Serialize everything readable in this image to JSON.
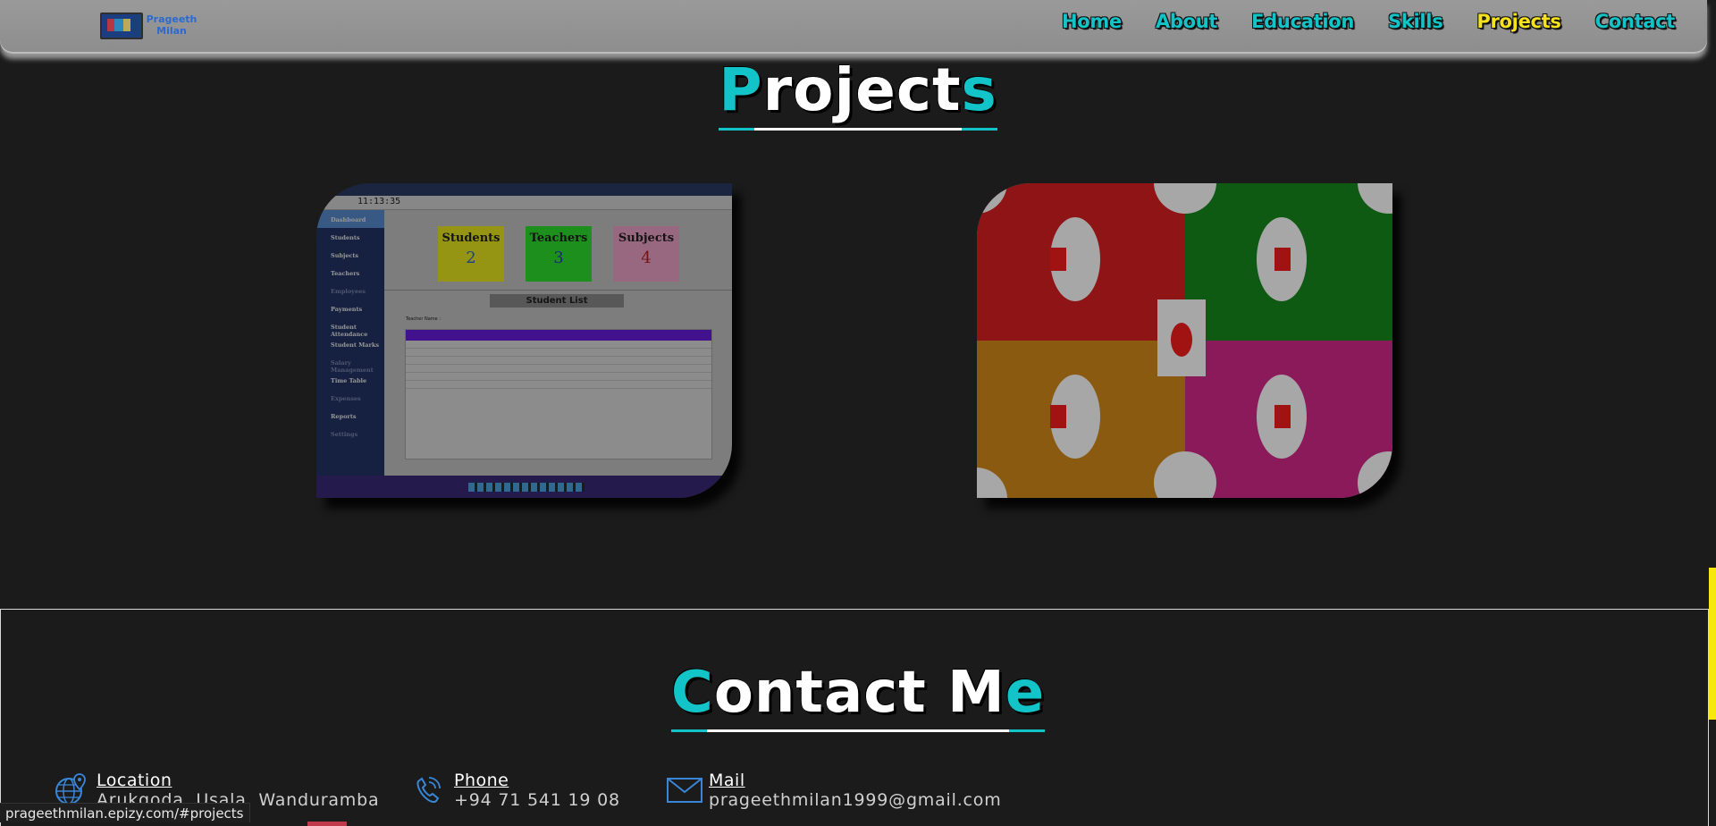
{
  "logo": {
    "line1": "Prageeth",
    "line2": "Milan"
  },
  "nav": {
    "items": [
      "Home",
      "About",
      "Education",
      "Skills",
      "Projects",
      "Contact"
    ],
    "active": "Projects"
  },
  "projects": {
    "title_first": "P",
    "title_middle": "roject",
    "title_last": "s",
    "cards": [
      {
        "kind": "school-management-screenshot",
        "clock": "11:13:35",
        "sidebar": [
          "Dashboard",
          "Students",
          "Subjects",
          "Teachers",
          "Employees",
          "Payments",
          "Student Attendance",
          "Student Marks",
          "Salary Management",
          "Time Table",
          "Expenses",
          "Reports",
          "Settings"
        ],
        "tiles": [
          {
            "label": "Students",
            "value": "2"
          },
          {
            "label": "Teachers",
            "value": "3"
          },
          {
            "label": "Subjects",
            "value": "4"
          }
        ],
        "list_title": "Student List",
        "filter_label": "Teacher Name :"
      },
      {
        "kind": "ludo-board-image"
      }
    ]
  },
  "contact": {
    "title_first": "C",
    "title_middle": "ontact M",
    "title_last": "e",
    "items": [
      {
        "label": "Location",
        "value": "Arukgoda, Usala, Wanduramba",
        "icon": "globe-location-icon"
      },
      {
        "label": "Phone",
        "value": "+94 71 541 19 08",
        "icon": "phone-icon"
      },
      {
        "label": "Mail",
        "value": "prageethmilan1999@gmail.com",
        "icon": "mail-icon"
      }
    ]
  },
  "status_bar": {
    "url": "prageethmilan.epizy.com/#projects"
  },
  "colors": {
    "accent": "#12c4c8",
    "active_nav": "#f5e21c",
    "background": "#1b1b1b",
    "scroll_indicator": "#f5e80a"
  }
}
